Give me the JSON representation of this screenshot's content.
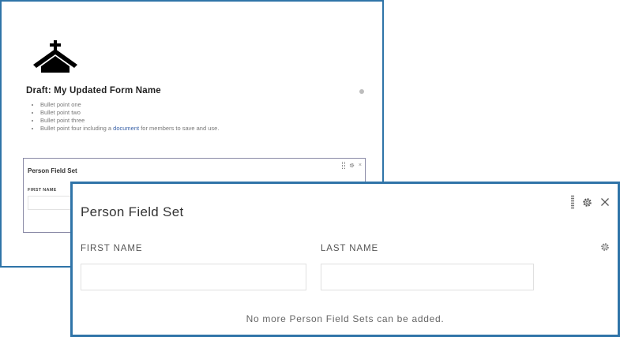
{
  "back": {
    "form_title": "Draft: My Updated Form Name",
    "bullets": [
      "Bullet point one",
      "Bullet point two",
      "Bullet point three"
    ],
    "bullet4_prefix": "Bullet point four including a",
    "bullet4_link": "document",
    "bullet4_suffix": "for members to save and use.",
    "mini_fieldset_title": "Person Field Set",
    "mini_first_name_label": "FIRST NAME",
    "mini_close_glyph": "×"
  },
  "front": {
    "fieldset_title": "Person Field Set",
    "first_name_label": "FIRST NAME",
    "last_name_label": "LAST NAME",
    "first_name_value": "",
    "last_name_value": "",
    "limit_message": "No more Person Field Sets can be added."
  },
  "icons": {
    "logo": "church-icon",
    "drag": "drag-handle-icon",
    "settings": "gear-icon",
    "close": "close-icon"
  },
  "colors": {
    "highlight_border": "#2f74a8",
    "link": "#3a62a8"
  }
}
